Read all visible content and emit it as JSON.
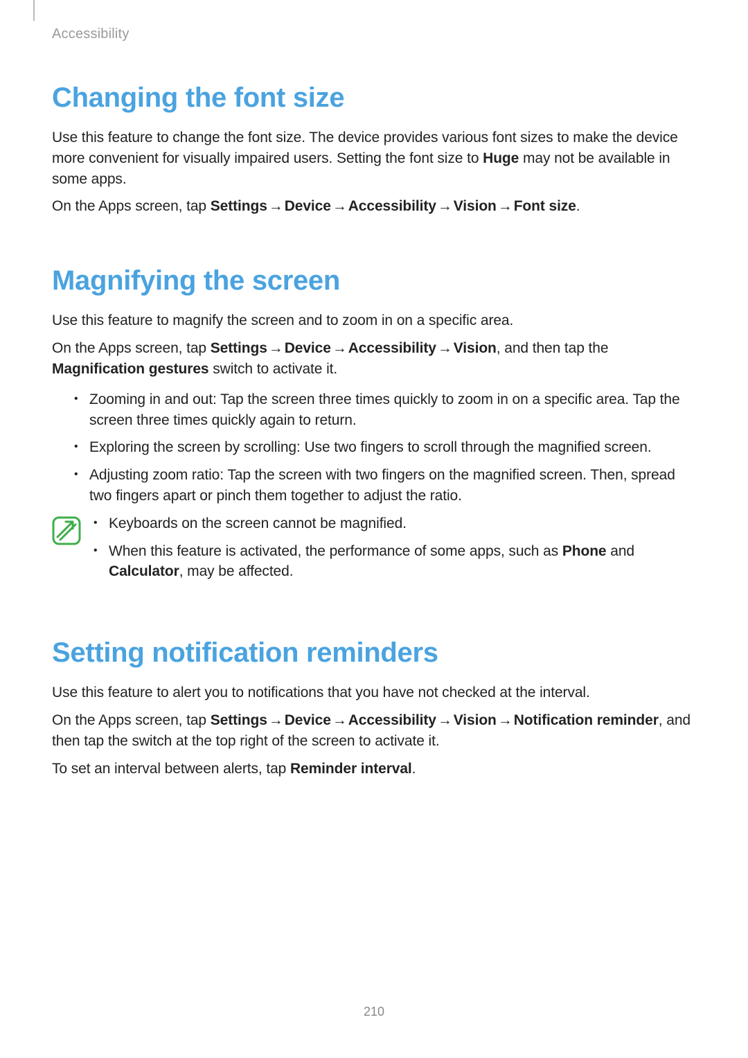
{
  "breadcrumb": "Accessibility",
  "page_number": "210",
  "arrow": "→",
  "sections": {
    "font_size": {
      "heading": "Changing the font size",
      "p1_a": "Use this feature to change the font size. The device provides various font sizes to make the device more convenient for visually impaired users. Setting the font size to ",
      "p1_bold": "Huge",
      "p1_b": " may not be available in some apps.",
      "p2_a": "On the Apps screen, tap ",
      "path_1": "Settings",
      "path_2": "Device",
      "path_3": "Accessibility",
      "path_4": "Vision",
      "path_5": "Font size",
      "p2_b": "."
    },
    "magnify": {
      "heading": "Magnifying the screen",
      "p1": "Use this feature to magnify the screen and to zoom in on a specific area.",
      "p2_a": "On the Apps screen, tap ",
      "path_1": "Settings",
      "path_2": "Device",
      "path_3": "Accessibility",
      "path_4": "Vision",
      "p2_b": ", and then tap the ",
      "p2_bold": "Magnification gestures",
      "p2_c": " switch to activate it.",
      "bullets": [
        "Zooming in and out: Tap the screen three times quickly to zoom in on a specific area. Tap the screen three times quickly again to return.",
        "Exploring the screen by scrolling: Use two fingers to scroll through the magnified screen.",
        "Adjusting zoom ratio: Tap the screen with two fingers on the magnified screen. Then, spread two fingers apart or pinch them together to adjust the ratio."
      ],
      "note1": "Keyboards on the screen cannot be magnified.",
      "note2_a": "When this feature is activated, the performance of some apps, such as ",
      "note2_bold1": "Phone",
      "note2_b": " and ",
      "note2_bold2": "Calculator",
      "note2_c": ", may be affected."
    },
    "reminders": {
      "heading": "Setting notification reminders",
      "p1": "Use this feature to alert you to notifications that you have not checked at the interval.",
      "p2_a": "On the Apps screen, tap ",
      "path_1": "Settings",
      "path_2": "Device",
      "path_3": "Accessibility",
      "path_4": "Vision",
      "path_5": "Notification reminder",
      "p2_b": ", and then tap the switch at the top right of the screen to activate it.",
      "p3_a": "To set an interval between alerts, tap ",
      "p3_bold": "Reminder interval",
      "p3_b": "."
    }
  }
}
